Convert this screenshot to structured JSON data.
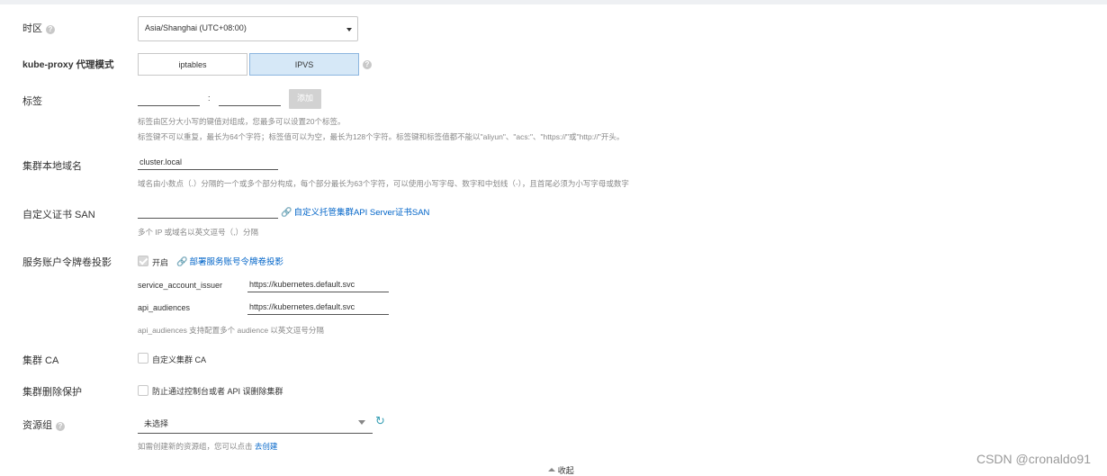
{
  "timezone": {
    "label": "时区",
    "value": "Asia/Shanghai (UTC+08:00)"
  },
  "proxy_mode": {
    "label": "kube-proxy 代理模式",
    "options": [
      "iptables",
      "IPVS"
    ],
    "selected": "IPVS"
  },
  "tags": {
    "label": "标签",
    "separator": ":",
    "key_value": "",
    "val_value": "",
    "add_button": "添加",
    "hint1": "标签由区分大小写的键值对组成，您最多可以设置20个标签。",
    "hint2": "标签键不可以重复，最长为64个字符；标签值可以为空，最长为128个字符。标签键和标签值都不能以\"aliyun\"、\"acs:\"、\"https://\"或\"http://\"开头。"
  },
  "domain": {
    "label": "集群本地域名",
    "value": "cluster.local",
    "hint": "域名由小数点（.）分隔的一个或多个部分构成，每个部分最长为63个字符，可以使用小写字母、数字和中划线（-），且首尾必须为小写字母或数字"
  },
  "cert_san": {
    "label": "自定义证书 SAN",
    "value": "",
    "link": "自定义托管集群API Server证书SAN",
    "hint": "多个 IP 或域名以英文逗号（,）分隔"
  },
  "sa_token": {
    "label": "服务账户令牌卷投影",
    "enable_label": "开启",
    "enabled": true,
    "link": "部署服务账号令牌卷投影",
    "issuer_label": "service_account_issuer",
    "issuer_value": "https://kubernetes.default.svc",
    "audiences_label": "api_audiences",
    "audiences_value": "https://kubernetes.default.svc",
    "hint": "api_audiences 支持配置多个 audience 以英文逗号分隔"
  },
  "cluster_ca": {
    "label": "集群 CA",
    "option": "自定义集群 CA",
    "checked": false
  },
  "delete_protection": {
    "label": "集群删除保护",
    "option": "防止通过控制台或者 API 误删除集群",
    "checked": false
  },
  "resource_group": {
    "label": "资源组",
    "value": "未选择",
    "hint": "如需创建新的资源组，您可以点击",
    "link": "去创建"
  },
  "collapse": {
    "label": "收起"
  },
  "watermark": "CSDN @cronaldo91",
  "colors": {
    "accent": "#0064c8",
    "selected_segment_bg": "#d6e8f7",
    "disabled_button": "#d2d2d2"
  }
}
